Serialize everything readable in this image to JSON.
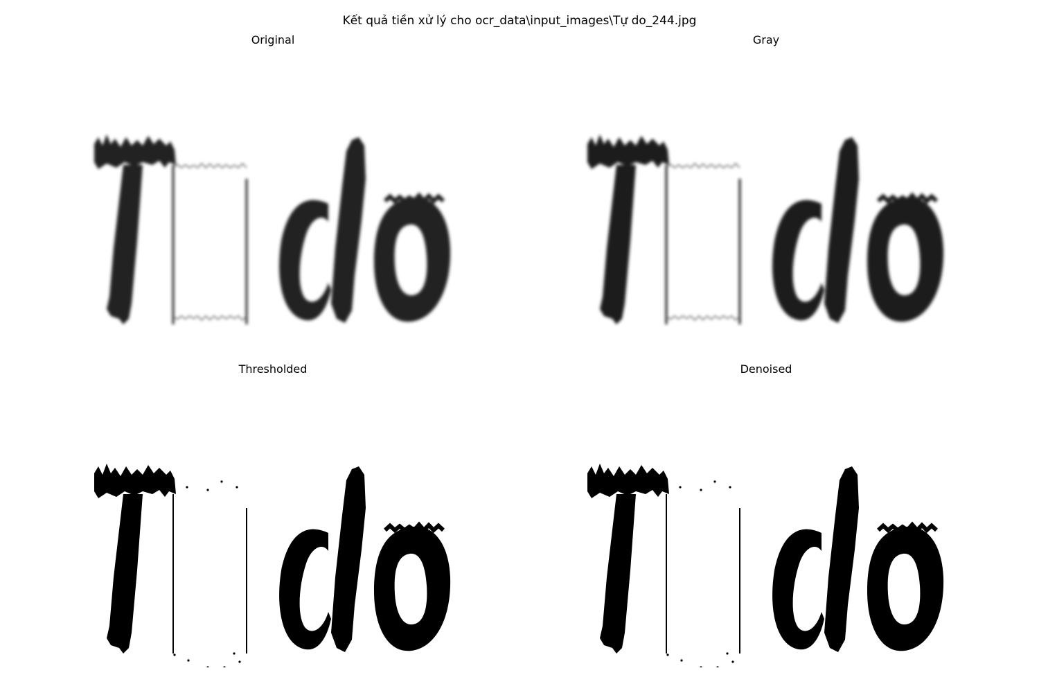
{
  "figure": {
    "suptitle": "Kết quả tiền xử lý cho ocr_data\\input_images\\Tự do_244.jpg"
  },
  "panels": [
    {
      "title": "Original",
      "style": "blurred",
      "ink_color": "#222222"
    },
    {
      "title": "Gray",
      "style": "blurred",
      "ink_color": "#1e1e1e"
    },
    {
      "title": "Thresholded",
      "style": "binary",
      "ink_color": "#000000"
    },
    {
      "title": "Denoised",
      "style": "binary",
      "ink_color": "#000000"
    }
  ]
}
